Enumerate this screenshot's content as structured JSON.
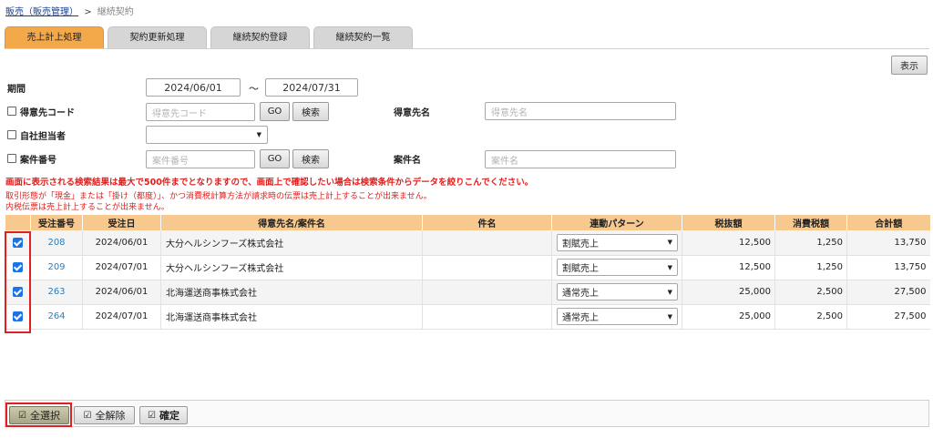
{
  "breadcrumb": {
    "parent": "販売（販売管理）",
    "separator": ">",
    "current": "継続契約"
  },
  "tabs": [
    {
      "label": "売上計上処理",
      "active": true
    },
    {
      "label": "契約更新処理",
      "active": false
    },
    {
      "label": "継続契約登録",
      "active": false
    },
    {
      "label": "継続契約一覧",
      "active": false
    }
  ],
  "toolbar": {
    "show_label": "表示"
  },
  "form": {
    "period_label": "期間",
    "period_from": "2024/06/01",
    "period_tilde": "～",
    "period_to": "2024/07/31",
    "customer_code_label": "得意先コード",
    "customer_code_placeholder": "得意先コード",
    "go_label": "GO",
    "search_label": "検索",
    "customer_name_label": "得意先名",
    "customer_name_placeholder": "得意先名",
    "staff_label": "自社担当者",
    "project_no_label": "案件番号",
    "project_no_placeholder": "案件番号",
    "project_name_label": "案件名",
    "project_name_placeholder": "案件名"
  },
  "messages": {
    "warning": "画面に表示される検索結果は最大で500件までとなりますので、画面上で確認したい場合は検索条件からデータを絞りこんでください。",
    "note1": "取引形態が「現金」または「掛け（都度）」、かつ消費税計算方法が請求時の伝票は売上計上することが出来ません。",
    "note2": "内税伝票は売上計上することが出来ません。"
  },
  "table": {
    "headers": [
      "受注番号",
      "受注日",
      "得意先名/案件名",
      "件名",
      "連動パターン",
      "税抜額",
      "消費税額",
      "合計額"
    ],
    "rows": [
      {
        "checked": true,
        "order_no": "208",
        "date": "2024/06/01",
        "customer": "大分ヘルシンフーズ株式会社",
        "subject": "",
        "pattern": "割賦売上",
        "net": "12,500",
        "tax": "1,250",
        "total": "13,750"
      },
      {
        "checked": true,
        "order_no": "209",
        "date": "2024/07/01",
        "customer": "大分ヘルシンフーズ株式会社",
        "subject": "",
        "pattern": "割賦売上",
        "net": "12,500",
        "tax": "1,250",
        "total": "13,750"
      },
      {
        "checked": true,
        "order_no": "263",
        "date": "2024/06/01",
        "customer": "北海運送商事株式会社",
        "subject": "",
        "pattern": "通常売上",
        "net": "25,000",
        "tax": "2,500",
        "total": "27,500"
      },
      {
        "checked": true,
        "order_no": "264",
        "date": "2024/07/01",
        "customer": "北海運送商事株式会社",
        "subject": "",
        "pattern": "通常売上",
        "net": "25,000",
        "tax": "2,500",
        "total": "27,500"
      }
    ]
  },
  "footer": {
    "select_all": "全選択",
    "clear_all": "全解除",
    "confirm": "確定"
  },
  "colors": {
    "tab_active": "#f3a84a",
    "header_bg": "#f7c98e",
    "highlight": "#e02020",
    "link": "#2c7fb8"
  }
}
